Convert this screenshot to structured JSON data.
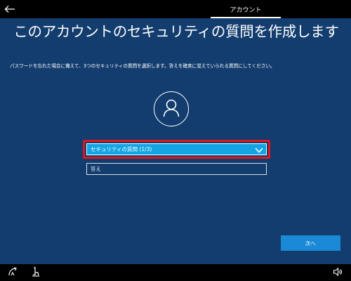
{
  "header": {
    "tab_label": "アカウント"
  },
  "main": {
    "title": "このアカウントのセキュリティの質問を作成します",
    "subtitle": "パスワードを忘れた場合に備えて、3つのセキュリティの質問を選択します。答えを確実に覚えていられる質問にしてください。",
    "question_dropdown": {
      "selected": "セキュリティの質問 (1/3)"
    },
    "answer_field": {
      "placeholder": "答え",
      "value": ""
    },
    "next_button_label": "次へ"
  },
  "footer": {
    "icons": [
      "ease-of-access-icon",
      "accessibility-icon",
      "volume-icon"
    ]
  },
  "colors": {
    "background": "#133d6e",
    "dropdown": "#14a4e4",
    "highlight": "#e0161e",
    "primary_button": "#1a89d6"
  }
}
